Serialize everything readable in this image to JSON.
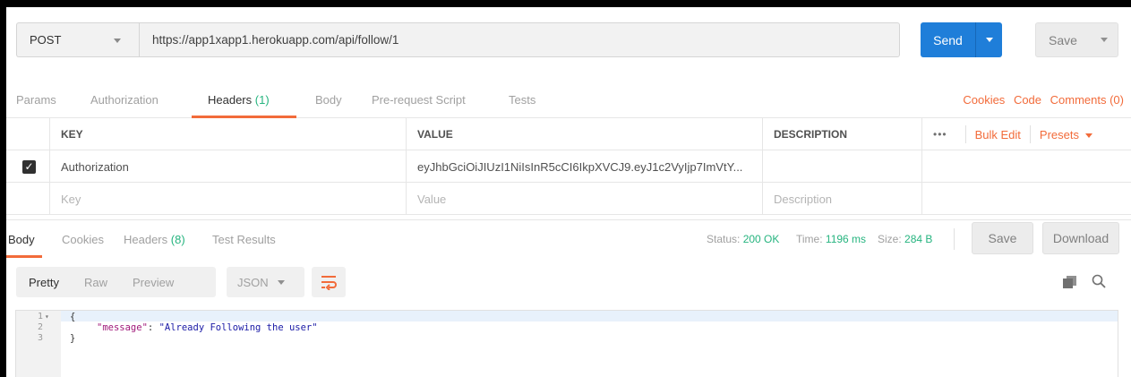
{
  "request": {
    "method": "POST",
    "url": "https://app1xapp1.herokuapp.com/api/follow/1",
    "send_label": "Send",
    "save_label": "Save"
  },
  "request_tabs": {
    "params": "Params",
    "authorization": "Authorization",
    "headers": "Headers",
    "headers_count": "(1)",
    "body": "Body",
    "prerequest": "Pre-request Script",
    "tests": "Tests",
    "cookies": "Cookies",
    "code": "Code",
    "comments": "Comments (0)"
  },
  "headers_table": {
    "col_key": "KEY",
    "col_value": "VALUE",
    "col_description": "DESCRIPTION",
    "dots": "•••",
    "bulk_edit": "Bulk Edit",
    "presets": "Presets",
    "rows": [
      {
        "checked": true,
        "key": "Authorization",
        "value": "eyJhbGciOiJIUzI1NiIsInR5cCI6IkpXVCJ9.eyJ1c2VyIjp7ImVtY...",
        "description": ""
      }
    ],
    "placeholder": {
      "key": "Key",
      "value": "Value",
      "description": "Description"
    }
  },
  "response_tabs": {
    "body": "Body",
    "cookies": "Cookies",
    "headers": "Headers",
    "headers_count": "(8)",
    "test_results": "Test Results"
  },
  "response_status": {
    "status_label": "Status:",
    "status_value": "200 OK",
    "time_label": "Time:",
    "time_value": "1196 ms",
    "size_label": "Size:",
    "size_value": "284 B",
    "save_label": "Save",
    "download_label": "Download"
  },
  "body_toolbar": {
    "pretty": "Pretty",
    "raw": "Raw",
    "preview": "Preview",
    "format": "JSON"
  },
  "code": {
    "line_numbers": [
      "1",
      "2",
      "3"
    ],
    "open_brace": "{",
    "key": "\"message\"",
    "colon": ": ",
    "value": "\"Already Following the user\"",
    "close_brace": "}"
  },
  "colors": {
    "accent": "#f26b3a",
    "send_blue": "#1f7ed9",
    "success_green": "#26b47f"
  }
}
